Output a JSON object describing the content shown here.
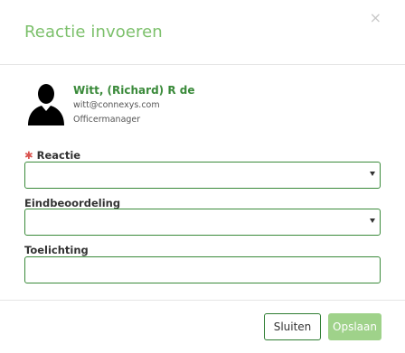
{
  "dialog": {
    "title": "Reactie invoeren",
    "close_glyph": "×"
  },
  "user": {
    "name": "Witt, (Richard) R de",
    "email": "witt@connexys.com",
    "role": "Officermanager",
    "avatar_icon": "user-silhouette-icon"
  },
  "form": {
    "required_marker": "✱",
    "reactie": {
      "label": "Reactie",
      "value": ""
    },
    "eindbeoordeling": {
      "label": "Eindbeoordeling",
      "value": ""
    },
    "toelichting": {
      "label": "Toelichting",
      "value": ""
    }
  },
  "footer": {
    "close_label": "Sluiten",
    "save_label": "Opslaan"
  },
  "colors": {
    "accent_green": "#7cc06b",
    "border_green": "#3a8a3a",
    "save_button_bg": "#9fd28a",
    "required_red": "#d9534f"
  }
}
